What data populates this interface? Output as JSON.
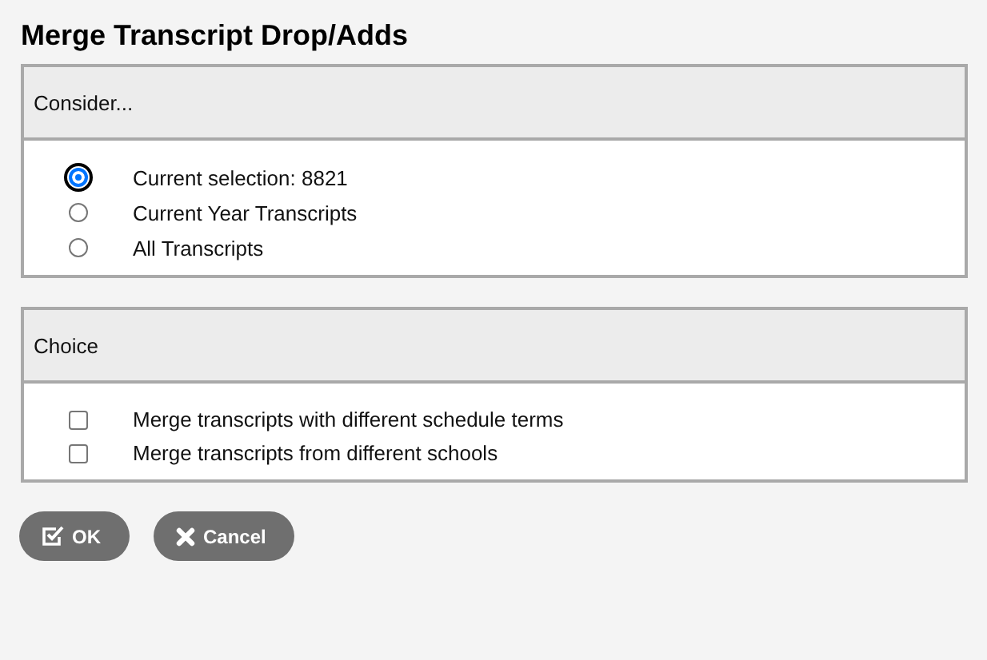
{
  "title": "Merge Transcript Drop/Adds",
  "sections": [
    {
      "heading": "Consider...",
      "kind": "radio",
      "options": [
        {
          "label": "Current selection: 8821",
          "selected": true
        },
        {
          "label": "Current Year Transcripts",
          "selected": false
        },
        {
          "label": "All Transcripts",
          "selected": false
        }
      ]
    },
    {
      "heading": "Choice",
      "kind": "checkbox",
      "options": [
        {
          "label": "Merge transcripts with different schedule terms",
          "checked": false
        },
        {
          "label": "Merge transcripts from different schools",
          "checked": false
        }
      ]
    }
  ],
  "buttons": [
    {
      "label": "OK",
      "kind": "ok"
    },
    {
      "label": "Cancel",
      "kind": "cancel"
    }
  ]
}
